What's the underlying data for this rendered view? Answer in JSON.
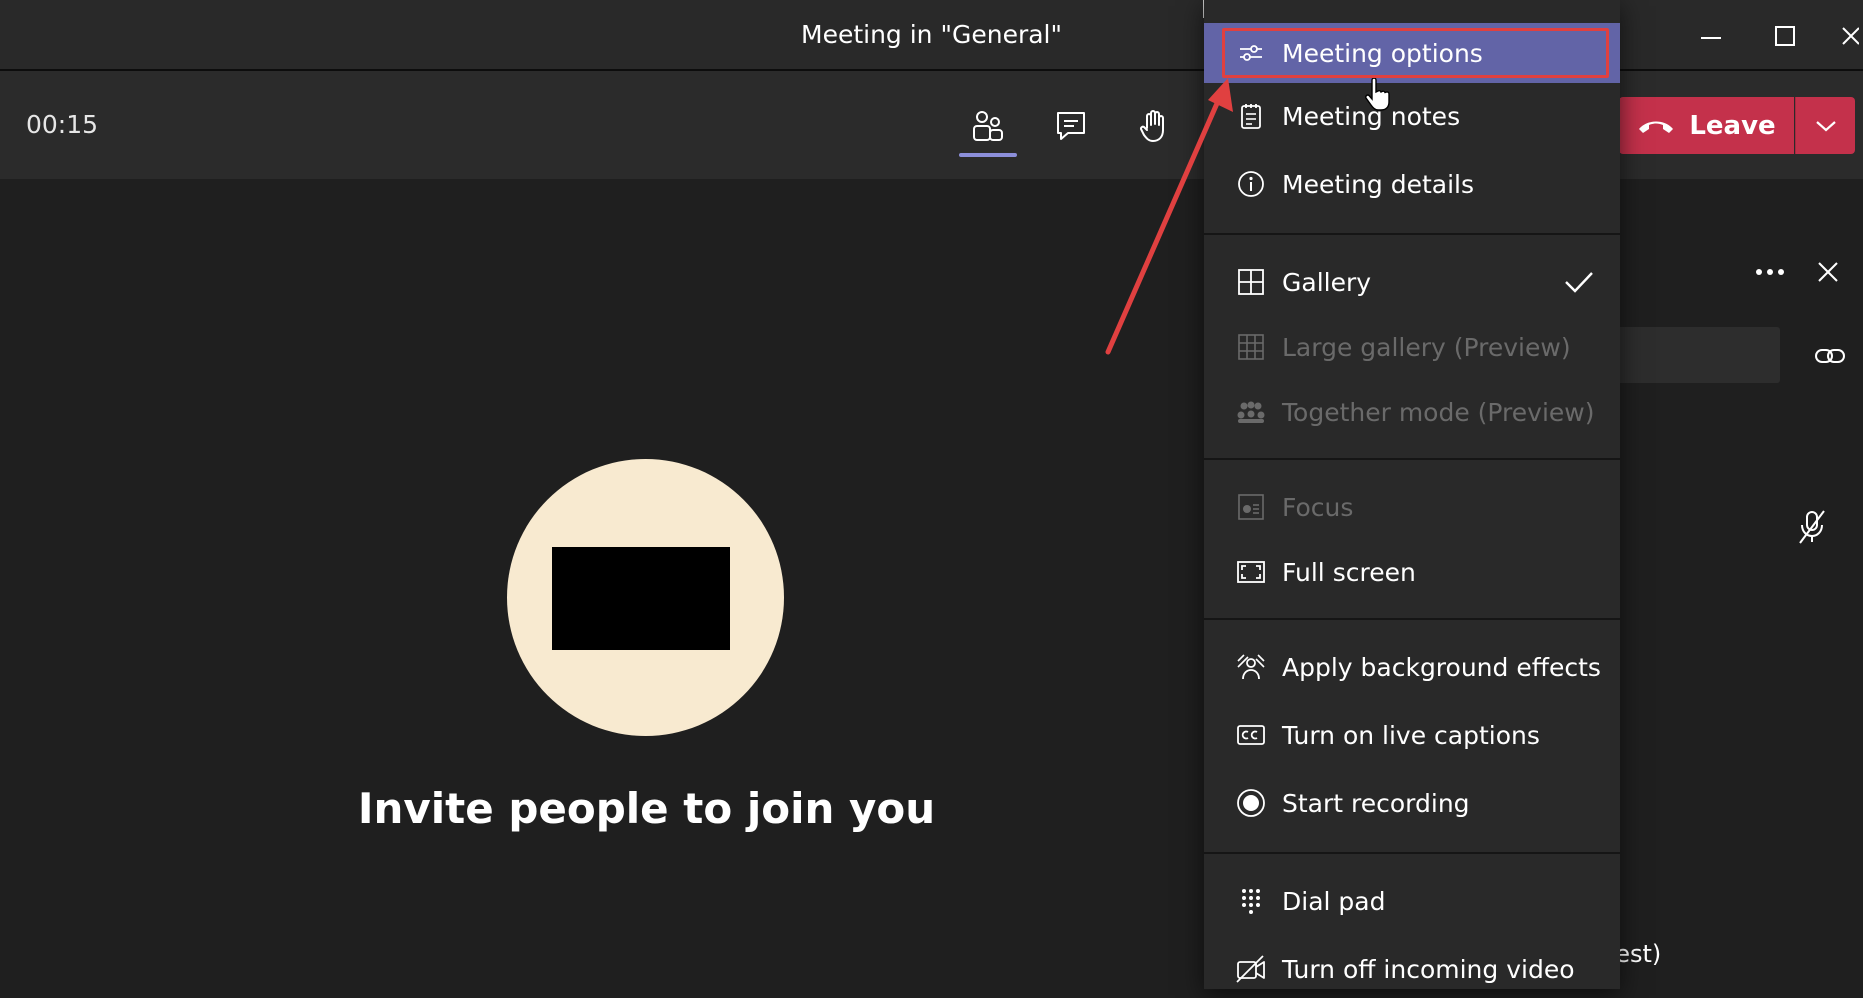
{
  "window": {
    "title": "Meeting in \"General\""
  },
  "toolbar": {
    "timer": "00:15",
    "leave_label": "Leave"
  },
  "stage": {
    "invite_text": "Invite people to join you"
  },
  "side_panel": {
    "guest_text_fragment": "uest)"
  },
  "menu": {
    "items": [
      {
        "label": "Meeting options",
        "icon": "sliders-icon",
        "state": "hover"
      },
      {
        "label": "Meeting notes",
        "icon": "notes-icon",
        "state": "enabled"
      },
      {
        "label": "Meeting details",
        "icon": "info-icon",
        "state": "enabled"
      },
      {
        "label": "Gallery",
        "icon": "gallery-icon",
        "state": "checked"
      },
      {
        "label": "Large gallery (Preview)",
        "icon": "large-gallery-icon",
        "state": "disabled"
      },
      {
        "label": "Together mode (Preview)",
        "icon": "together-mode-icon",
        "state": "disabled"
      },
      {
        "label": "Focus",
        "icon": "focus-icon",
        "state": "disabled"
      },
      {
        "label": "Full screen",
        "icon": "fullscreen-icon",
        "state": "enabled"
      },
      {
        "label": "Apply background effects",
        "icon": "background-effects-icon",
        "state": "enabled"
      },
      {
        "label": "Turn on live captions",
        "icon": "captions-icon",
        "state": "enabled"
      },
      {
        "label": "Start recording",
        "icon": "record-icon",
        "state": "enabled"
      },
      {
        "label": "Dial pad",
        "icon": "dialpad-icon",
        "state": "enabled"
      },
      {
        "label": "Turn off incoming video",
        "icon": "video-off-icon",
        "state": "enabled"
      }
    ]
  },
  "colors": {
    "accent": "#6264a7",
    "leave": "#c4314b",
    "annotation": "#e04040"
  }
}
